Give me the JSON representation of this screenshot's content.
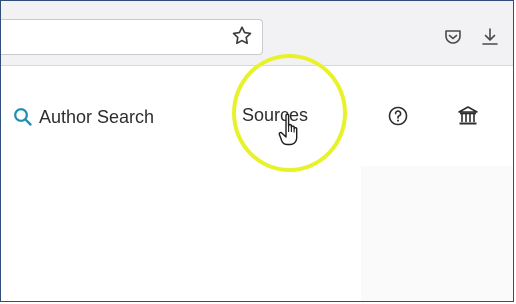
{
  "toolbar": {
    "url": "",
    "icons": [
      "bookmark-star-icon",
      "pocket-icon",
      "download-icon"
    ]
  },
  "nav": {
    "author_search": "Author Search",
    "sources": "Sources",
    "icons": [
      "search-icon",
      "help-icon",
      "institution-icon"
    ]
  },
  "colors": {
    "accent_search_icon": "#1f8fae",
    "highlight_ring": "#e8f22a",
    "text": "#2e2e2e"
  }
}
